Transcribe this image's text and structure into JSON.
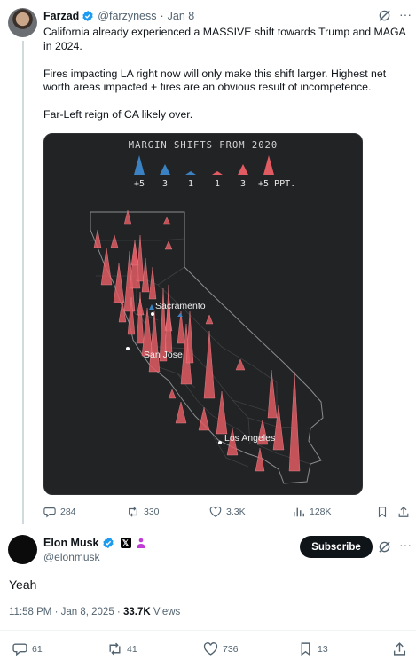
{
  "parent": {
    "author_name": "Farzad",
    "handle": "@farzyness",
    "separator": "·",
    "date": "Jan 8",
    "paragraphs": [
      "California already experienced a MASSIVE shift towards Trump and MAGA in 2024.",
      "Fires impacting LA right now will only make this shift larger. Highest net worth areas impacted + fires are an obvious result of incompetence.",
      "Far-Left reign of CA likely over."
    ],
    "map": {
      "title": "MARGIN SHIFTS FROM 2020",
      "legend": [
        "+5",
        "3",
        "1",
        "1",
        "3",
        "+5 PPT."
      ],
      "cities": [
        "Sacramento",
        "San Jose",
        "Los Angeles"
      ],
      "colors": {
        "dem": "#3b82c4",
        "rep": "#e15b63",
        "background": "#222325"
      }
    },
    "actions": {
      "replies": "284",
      "reposts": "330",
      "likes": "3.3K",
      "views": "128K"
    }
  },
  "main": {
    "author_name": "Elon Musk",
    "handle": "@elonmusk",
    "subscribe_label": "Subscribe",
    "text": "Yeah",
    "time": "11:58 PM",
    "date": "Jan 8, 2025",
    "views_count": "33.7K",
    "views_label": "Views",
    "actions": {
      "replies": "61",
      "reposts": "41",
      "likes": "736",
      "bookmarks": "13"
    }
  },
  "icons": {
    "reply": "speech-bubble-icon",
    "repost": "repost-arrows-icon",
    "like": "heart-icon",
    "views": "bar-chart-icon",
    "bookmark": "bookmark-icon",
    "share": "share-upload-icon",
    "grok": "grok-slash-icon",
    "more": "more-dots-icon",
    "verified": "verified-badge-icon"
  },
  "colors": {
    "accent": "#1d9bf0",
    "muted": "#536471",
    "text": "#0f1419"
  }
}
